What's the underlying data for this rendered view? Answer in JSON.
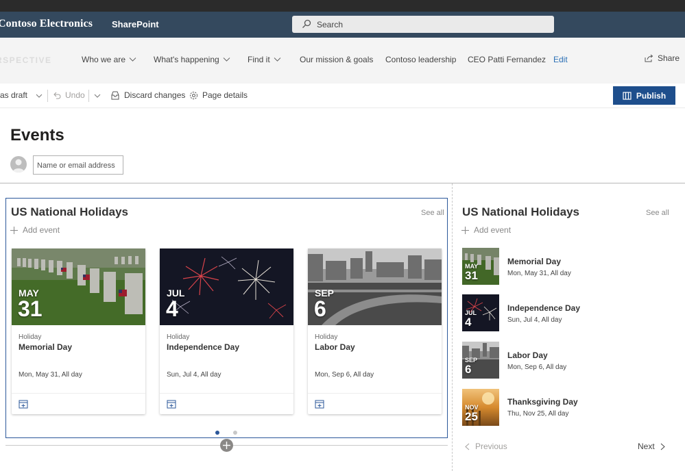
{
  "suite": {
    "brand": "Contoso Electronics",
    "app": "SharePoint",
    "search_placeholder": "Search"
  },
  "hub": {
    "logo": "RSPECTIVE",
    "nav": [
      {
        "label": "Who we are",
        "dropdown": true
      },
      {
        "label": "What's happening",
        "dropdown": true
      },
      {
        "label": "Find it",
        "dropdown": true
      },
      {
        "label": "Our mission & goals",
        "dropdown": false
      },
      {
        "label": "Contoso leadership",
        "dropdown": false
      },
      {
        "label": "CEO Patti Fernandez",
        "dropdown": false
      }
    ],
    "edit_label": "Edit",
    "share_label": "Share"
  },
  "command": {
    "save_draft": "as draft",
    "undo": "Undo",
    "discard": "Discard changes",
    "details": "Page details",
    "publish": "Publish"
  },
  "page": {
    "title": "Events",
    "people_placeholder": "Name or email address"
  },
  "events_left": {
    "title": "US National Holidays",
    "see_all": "See all",
    "add_event": "Add event",
    "cards": [
      {
        "month": "MAY",
        "day": "31",
        "category": "Holiday",
        "name": "Memorial Day",
        "when": "Mon, May 31, All day"
      },
      {
        "month": "JUL",
        "day": "4",
        "category": "Holiday",
        "name": "Independence Day",
        "when": "Sun, Jul 4, All day"
      },
      {
        "month": "SEP",
        "day": "6",
        "category": "Holiday",
        "name": "Labor Day",
        "when": "Mon, Sep 6, All day"
      }
    ]
  },
  "events_right": {
    "title": "US National Holidays",
    "see_all": "See all",
    "add_event": "Add event",
    "items": [
      {
        "month": "MAY",
        "day": "31",
        "name": "Memorial Day",
        "when": "Mon, May 31, All day"
      },
      {
        "month": "JUL",
        "day": "4",
        "name": "Independence Day",
        "when": "Sun, Jul 4, All day"
      },
      {
        "month": "SEP",
        "day": "6",
        "name": "Labor Day",
        "when": "Mon, Sep 6, All day"
      },
      {
        "month": "NOV",
        "day": "25",
        "name": "Thanksgiving Day",
        "when": "Thu, Nov 25, All day"
      }
    ],
    "previous": "Previous",
    "next": "Next"
  },
  "colors": {
    "suite_bar": "#34495e",
    "accent": "#1e4e8c",
    "link": "#2a6fb5",
    "selection_border": "#2b579a"
  }
}
